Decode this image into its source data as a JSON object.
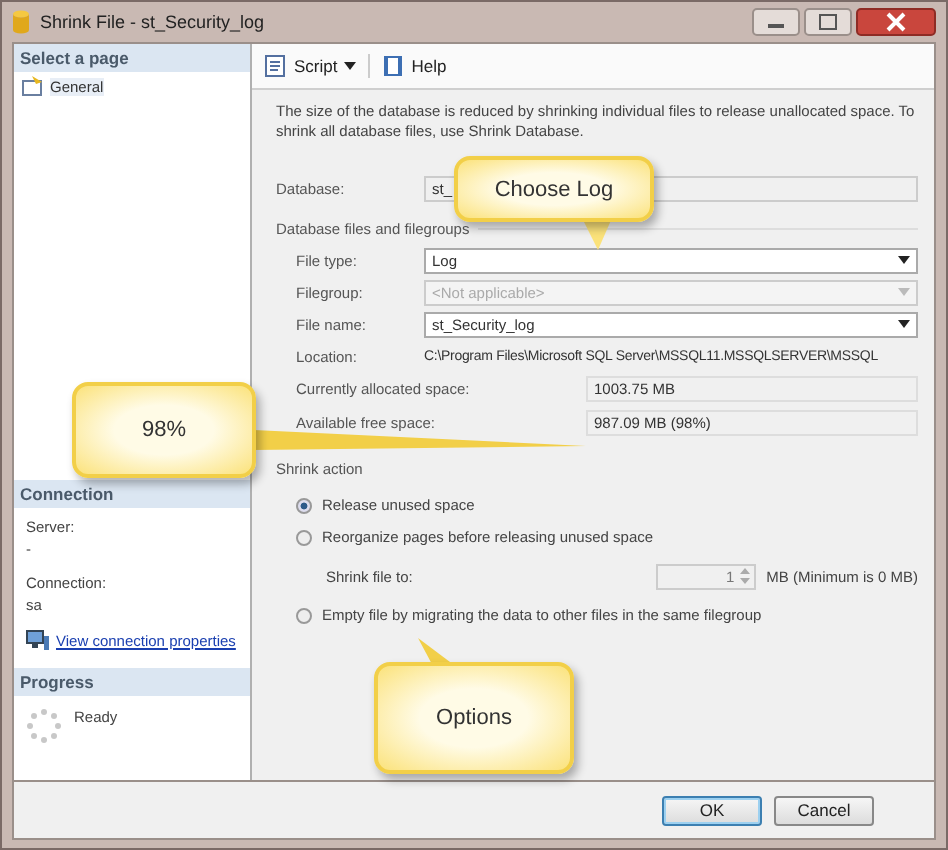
{
  "window": {
    "title": "Shrink File - st_Security_log"
  },
  "sidebar": {
    "select_header": "Select a page",
    "pages": [
      {
        "label": "General",
        "selected": true
      }
    ],
    "connection_header": "Connection",
    "server_label": "Server:",
    "server_value": "-",
    "connection_label": "Connection:",
    "connection_value": "sa",
    "link": "View connection properties",
    "progress_header": "Progress",
    "status": "Ready"
  },
  "toolbar": [
    {
      "label": "Script",
      "kind": "dropdown"
    },
    {
      "label": "Help",
      "kind": "plain"
    }
  ],
  "description": "The size of the database is reduced by shrinking individual files to release unallocated space. To shrink all database files, use Shrink Database.",
  "database": {
    "label": "Database:",
    "value": "st_"
  },
  "files_group": "Database files and filegroups",
  "fields": [
    {
      "label": "File type:",
      "value": "Log",
      "kind": "select",
      "disabled": false
    },
    {
      "label": "Filegroup:",
      "value": "<Not applicable>",
      "kind": "select",
      "disabled": true
    },
    {
      "label": "File name:",
      "value": "st_Security_log",
      "kind": "select",
      "disabled": false
    },
    {
      "label": "Location:",
      "value": "C:\\Program Files\\Microsoft SQL Server\\MSSQL11.MSSQLSERVER\\MSSQL",
      "kind": "text",
      "disabled": false
    }
  ],
  "space": [
    {
      "label": "Currently allocated space:",
      "value": "1003.75 MB"
    },
    {
      "label": "Available free space:",
      "value": "987.09 MB (98%)"
    }
  ],
  "shrink_action": {
    "title": "Shrink action",
    "options": [
      {
        "label": "Release unused space",
        "selected": true
      },
      {
        "label": "Reorganize pages before releasing unused space",
        "selected": false
      },
      {
        "label": "Empty file by migrating the data to other files in the same filegroup",
        "selected": false
      }
    ],
    "shrink_to": {
      "label": "Shrink file to:",
      "value": "1",
      "unit": "MB (Minimum is 0 MB)",
      "disabled": true
    }
  },
  "buttons": [
    {
      "label": "OK",
      "default": true
    },
    {
      "label": "Cancel",
      "default": false
    }
  ],
  "callouts": [
    {
      "text": "Choose Log",
      "kind": "log"
    },
    {
      "text": "98%",
      "kind": "free"
    },
    {
      "text": "Options",
      "kind": "options"
    }
  ]
}
